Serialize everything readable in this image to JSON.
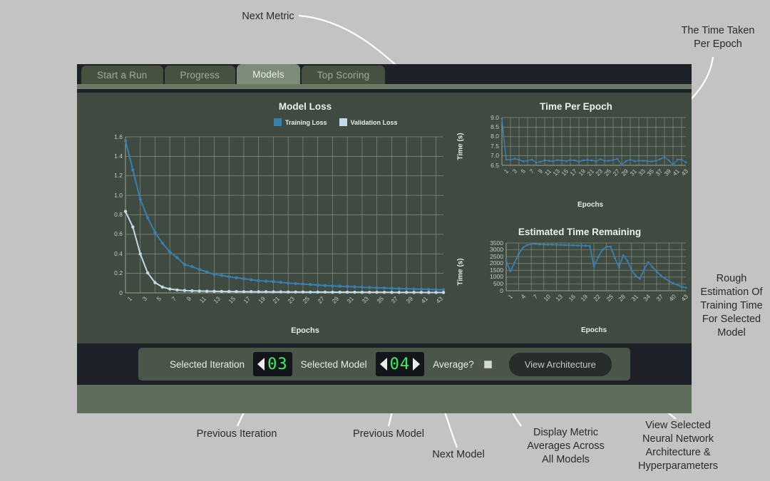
{
  "window": {
    "tabs": [
      {
        "label": "Start a Run",
        "active": false
      },
      {
        "label": "Progress",
        "active": false
      },
      {
        "label": "Models",
        "active": true
      },
      {
        "label": "Top Scoring",
        "active": false
      }
    ]
  },
  "controls": {
    "iteration_label": "Selected Iteration",
    "iteration_value": "03",
    "model_label": "Selected Model",
    "model_value": "04",
    "average_label": "Average?",
    "average_checked": false,
    "view_architecture_label": "View Architecture"
  },
  "annotations": [
    {
      "id": "next-metric",
      "text": "Next Metric"
    },
    {
      "id": "time-taken-per-epoch",
      "text": "The Time Taken\nPer Epoch"
    },
    {
      "id": "rough-estimation",
      "text": "Rough\nEstimation Of\nTraining Time\nFor Selected\nModel"
    },
    {
      "id": "previous-iteration",
      "text": "Previous Iteration"
    },
    {
      "id": "previous-model",
      "text": "Previous Model"
    },
    {
      "id": "next-model",
      "text": "Next Model"
    },
    {
      "id": "display-averages",
      "text": "Display Metric\nAverages Across\nAll Models"
    },
    {
      "id": "view-architecture-note",
      "text": "View Selected\nNeural Network\nArchitecture &\nHyperparameters"
    }
  ],
  "colors": {
    "training_loss": "#3a7fb0",
    "validation_loss": "#c3d9e8",
    "chart_bg": "#3f4a40",
    "grid": "#9aa595",
    "panel_bg": "#4b554a",
    "bar_bg": "#1e2228",
    "footer_bg": "#5f6e5b",
    "tab_active": "#7d8c78",
    "tab_inactive": "#475140",
    "lcd_green": "#3bf063",
    "page_bg": "#c3c3c3"
  },
  "chart_data": [
    {
      "id": "model-loss",
      "type": "line",
      "title": "Model Loss",
      "xlabel": "Epochs",
      "ylabel": "",
      "grid": true,
      "legend": [
        "Training Loss",
        "Validation Loss"
      ],
      "legend_position": "top",
      "xlim": [
        1,
        44
      ],
      "ylim": [
        0,
        1.6
      ],
      "yticks": [
        0,
        0.2,
        0.4,
        0.6,
        0.8,
        1.0,
        1.2,
        1.4,
        1.6
      ],
      "ytick_labels": [
        "0",
        "0.2",
        "0.4",
        "0.6",
        "0.8",
        "1.0",
        "1.2",
        "1.4",
        "1.6"
      ],
      "xticks": [
        1,
        3,
        5,
        7,
        9,
        11,
        13,
        15,
        17,
        19,
        21,
        23,
        25,
        27,
        29,
        31,
        33,
        35,
        37,
        39,
        41,
        43
      ],
      "x": [
        1,
        2,
        3,
        4,
        5,
        6,
        7,
        8,
        9,
        10,
        11,
        12,
        13,
        14,
        15,
        16,
        17,
        18,
        19,
        20,
        21,
        22,
        23,
        24,
        25,
        26,
        27,
        28,
        29,
        30,
        31,
        32,
        33,
        34,
        35,
        36,
        37,
        38,
        39,
        40,
        41,
        42,
        43,
        44
      ],
      "series": [
        {
          "name": "Training Loss",
          "color": "#3a7fb0",
          "values": [
            1.56,
            1.26,
            0.96,
            0.77,
            0.62,
            0.51,
            0.42,
            0.36,
            0.29,
            0.27,
            0.24,
            0.215,
            0.19,
            0.18,
            0.165,
            0.155,
            0.145,
            0.135,
            0.125,
            0.12,
            0.115,
            0.108,
            0.1,
            0.095,
            0.09,
            0.085,
            0.08,
            0.075,
            0.072,
            0.068,
            0.065,
            0.062,
            0.058,
            0.055,
            0.052,
            0.05,
            0.047,
            0.044,
            0.042,
            0.04,
            0.038,
            0.036,
            0.034,
            0.032
          ]
        },
        {
          "name": "Validation Loss",
          "color": "#c3d9e8",
          "values": [
            0.835,
            0.675,
            0.4,
            0.205,
            0.105,
            0.06,
            0.04,
            0.03,
            0.024,
            0.021,
            0.019,
            0.017,
            0.016,
            0.015,
            0.014,
            0.013,
            0.012,
            0.012,
            0.011,
            0.011,
            0.01,
            0.01,
            0.009,
            0.009,
            0.009,
            0.008,
            0.008,
            0.008,
            0.007,
            0.007,
            0.007,
            0.007,
            0.006,
            0.006,
            0.006,
            0.006,
            0.005,
            0.005,
            0.005,
            0.005,
            0.005,
            0.004,
            0.004,
            0.004
          ]
        }
      ]
    },
    {
      "id": "time-per-epoch",
      "type": "line",
      "title": "Time Per Epoch",
      "xlabel": "Epochs",
      "ylabel": "Time (s)",
      "grid": true,
      "xlim": [
        1,
        44
      ],
      "ylim": [
        6.5,
        9.0
      ],
      "yticks": [
        6.5,
        7.0,
        7.5,
        8.0,
        8.5,
        9.0
      ],
      "ytick_labels": [
        "6.5",
        "7.0",
        "7.5",
        "8.0",
        "8.5",
        "9.0"
      ],
      "xticks": [
        1,
        3,
        5,
        7,
        9,
        11,
        13,
        15,
        17,
        19,
        21,
        23,
        25,
        27,
        29,
        31,
        33,
        35,
        37,
        39,
        41,
        43
      ],
      "x": [
        1,
        2,
        3,
        4,
        5,
        6,
        7,
        8,
        9,
        10,
        11,
        12,
        13,
        14,
        15,
        16,
        17,
        18,
        19,
        20,
        21,
        22,
        23,
        24,
        25,
        26,
        27,
        28,
        29,
        30,
        31,
        32,
        33,
        34,
        35,
        36,
        37,
        38,
        39,
        40,
        41,
        42,
        43,
        44
      ],
      "series": [
        {
          "name": "Time Per Epoch",
          "color": "#3a7fb0",
          "values": [
            8.93,
            6.8,
            6.79,
            6.85,
            6.8,
            6.7,
            6.74,
            6.8,
            6.65,
            6.68,
            6.76,
            6.74,
            6.72,
            6.78,
            6.75,
            6.72,
            6.78,
            6.76,
            6.7,
            6.76,
            6.78,
            6.76,
            6.72,
            6.82,
            6.74,
            6.74,
            6.78,
            6.84,
            6.52,
            6.72,
            6.8,
            6.72,
            6.74,
            6.74,
            6.72,
            6.7,
            6.74,
            6.82,
            6.94,
            6.76,
            6.52,
            6.8,
            6.8,
            6.66
          ]
        }
      ]
    },
    {
      "id": "estimated-time-remaining",
      "type": "line",
      "title": "Estimated Time Remaining",
      "xlabel": "Epochs",
      "ylabel": "Time (s)",
      "grid": true,
      "xlim": [
        1,
        44
      ],
      "ylim": [
        0,
        3500
      ],
      "yticks": [
        0,
        500,
        1000,
        1500,
        2000,
        2500,
        3000,
        3500
      ],
      "ytick_labels": [
        "0",
        "500",
        "1000",
        "1500",
        "2000",
        "2500",
        "3000",
        "3500"
      ],
      "xticks": [
        1,
        4,
        7,
        10,
        13,
        16,
        19,
        22,
        25,
        28,
        31,
        34,
        37,
        40,
        43
      ],
      "x": [
        1,
        2,
        3,
        4,
        5,
        6,
        7,
        8,
        9,
        10,
        11,
        12,
        13,
        14,
        15,
        16,
        17,
        18,
        19,
        20,
        21,
        22,
        23,
        24,
        25,
        26,
        27,
        28,
        29,
        30,
        31,
        32,
        33,
        34,
        35,
        36,
        37,
        38,
        39,
        40,
        41,
        42,
        43,
        44
      ],
      "series": [
        {
          "name": "Estimated Time Remaining",
          "color": "#3a7fb0",
          "values": [
            2200,
            1420,
            2050,
            2700,
            3150,
            3350,
            3430,
            3440,
            3400,
            3390,
            3380,
            3380,
            3370,
            3360,
            3350,
            3340,
            3330,
            3320,
            3310,
            3300,
            3290,
            1780,
            2450,
            3000,
            3230,
            3240,
            2400,
            1720,
            2600,
            2200,
            1500,
            1100,
            880,
            1570,
            2080,
            1750,
            1400,
            1120,
            900,
            700,
            540,
            420,
            300,
            220
          ]
        }
      ]
    }
  ]
}
